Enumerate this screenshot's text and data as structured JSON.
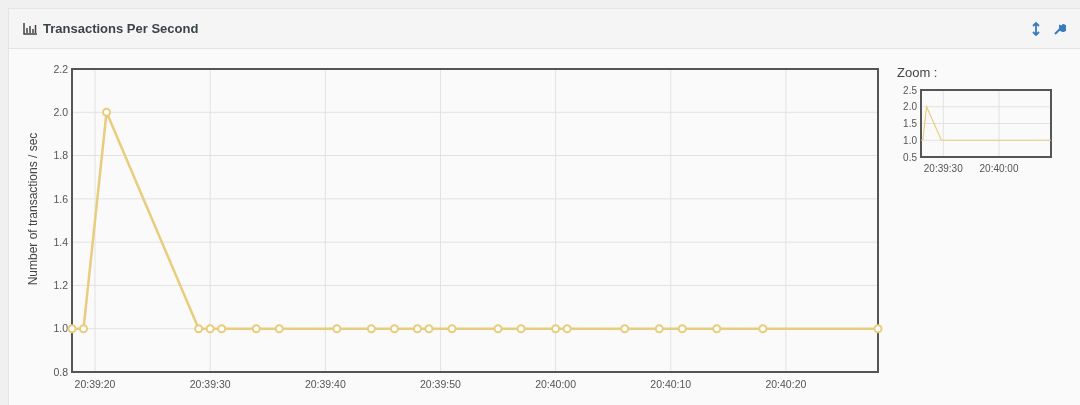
{
  "panel": {
    "title": "Transactions Per Second"
  },
  "main_chart": {
    "chart_data": {
      "type": "line",
      "ylabel": "Number of transactions / sec",
      "x": [
        74358,
        74359,
        74361,
        74369,
        74370,
        74371,
        74374,
        74376,
        74381,
        74384,
        74386,
        74388,
        74389,
        74391,
        74395,
        74397,
        74400,
        74401,
        74406,
        74409,
        74411,
        74414,
        74418,
        74428
      ],
      "series": [
        {
          "color": "#e8cd7e",
          "marker": "circle",
          "values": [
            1,
            1,
            2,
            1,
            1,
            1,
            1,
            1,
            1,
            1,
            1,
            1,
            1,
            1,
            1,
            1,
            1,
            1,
            1,
            1,
            1,
            1,
            1,
            1
          ]
        }
      ],
      "xlim": [
        74358,
        74428
      ],
      "ylim": [
        0.8,
        2.2
      ],
      "grid": true,
      "xticks": [
        {
          "value": 74360,
          "label": "20:39:20"
        },
        {
          "value": 74370,
          "label": "20:39:30"
        },
        {
          "value": 74380,
          "label": "20:39:40"
        },
        {
          "value": 74390,
          "label": "20:39:50"
        },
        {
          "value": 74400,
          "label": "20:40:00"
        },
        {
          "value": 74410,
          "label": "20:40:10"
        },
        {
          "value": 74420,
          "label": "20:40:20"
        }
      ],
      "yticks": [
        {
          "value": 0.8,
          "label": "0.8"
        },
        {
          "value": 1,
          "label": "1.0"
        },
        {
          "value": 1.2,
          "label": "1.2"
        },
        {
          "value": 1.4,
          "label": "1.4"
        },
        {
          "value": 1.6,
          "label": "1.6"
        },
        {
          "value": 1.8,
          "label": "1.8"
        },
        {
          "value": 2,
          "label": "2.0"
        },
        {
          "value": 2.2,
          "label": "2.2"
        }
      ]
    }
  },
  "zoom": {
    "label": "Zoom :",
    "chart_data": {
      "type": "line",
      "x": [
        74358,
        74359,
        74361,
        74369,
        74370,
        74428
      ],
      "series": [
        {
          "color": "#e8cd7e",
          "values": [
            1,
            1,
            2,
            1,
            1,
            1
          ]
        }
      ],
      "xlim": [
        74358,
        74428
      ],
      "ylim": [
        0.5,
        2.5
      ],
      "grid": true,
      "xticks": [
        {
          "value": 74370,
          "label": "20:39:30"
        },
        {
          "value": 74400,
          "label": "20:40:00"
        }
      ],
      "yticks": [
        {
          "value": 0.5,
          "label": "0.5"
        },
        {
          "value": 1,
          "label": "1.0"
        },
        {
          "value": 1.5,
          "label": "1.5"
        },
        {
          "value": 2,
          "label": "2.0"
        },
        {
          "value": 2.5,
          "label": "2.5"
        }
      ]
    }
  }
}
